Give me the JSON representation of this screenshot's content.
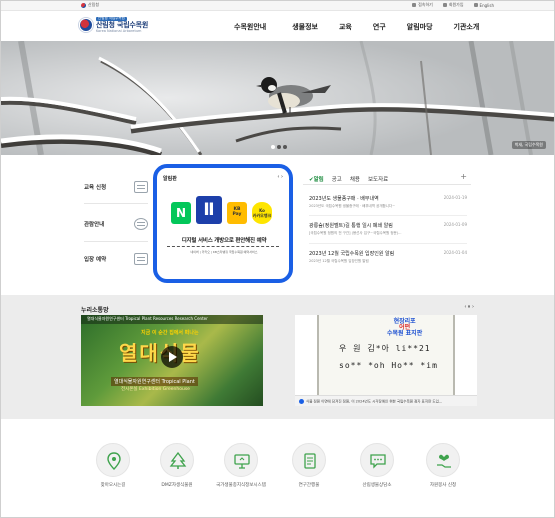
{
  "util": {
    "gov_label": "산림청",
    "links": [
      "접속하기",
      "회원가입",
      "English"
    ]
  },
  "logo": {
    "small": "산림청 국립수목원",
    "ko": "산림청 국립수목원",
    "en": "Korea National Arboretum"
  },
  "nav": [
    "수목원안내",
    "생물정보",
    "교육",
    "연구",
    "알림마당",
    "기관소개"
  ],
  "hero": {
    "caption": "박새, 국립수목원",
    "slide_count": 3
  },
  "quick_links": [
    "교육 신청",
    "관람안내",
    "입장 예약"
  ],
  "notice_panel": {
    "title": "알림판",
    "control": "‹ ›",
    "tiles": {
      "naver": "N",
      "big": "Ⅱ",
      "kbpay_top": "KB",
      "kbpay_bottom": "Pay",
      "kakao_top": "Ko",
      "kakao_bottom": "카카오뱅크"
    },
    "message": "디지털 서비스 개방으로 편안해진 예약",
    "fineprint": "네이버 | 카카오 | KB스타뱅킹 국립수목원 예약서비스"
  },
  "board": {
    "tabs": [
      "✔알림",
      "공고",
      "채용",
      "보도자료"
    ],
    "plus": "+",
    "items": [
      {
        "title": "2023년도 생물종구매 · 배부내역",
        "date": "2024-01-19",
        "summary": "2023년도 국립수목원 생물종구매 · 배부내역 공개합니다~"
      },
      {
        "title": "광릉숲(정원벨트)길 통행 일시 폐쇄 알림",
        "date": "2024-01-09",
        "summary": "[국립수목원 정원의 전 구간] (봉선사 입구~국립수목원 정문)..."
      },
      {
        "title": "2023년 12월 국립수목원 입장인원 알림",
        "date": "2024-01-04",
        "summary": "2023년 12월 국립수목원 입장인원 알림"
      }
    ]
  },
  "media": {
    "title": "누리소통망",
    "control": "‹ ⏸ ›",
    "video1": {
      "band": "열대식물자원연구센터 Tropical Plant Resources Research Center",
      "sub": "지금 이 순간 집에서 떠나는",
      "big": "열대식물",
      "cap1": "열대식물자원연구센터 Tropical Plant",
      "cap2": "전시온실 Exhibition Greenhouse"
    },
    "video2": {
      "label_top": "현장리포",
      "label_mid": "어떤",
      "label_bottom": "수목원 표지판",
      "line1": "우 원  김*아  li**21",
      "line2": "so** *oh  Ho** *im",
      "strip": "식물 정원 이면에 담겨진 정원, 이 2024년도 시각장애인 위한 국립수목원 점자 표지판 도입..."
    }
  },
  "bottom_icons": [
    {
      "label": "찾아오시는길",
      "icon": "map-pin-icon"
    },
    {
      "label": "DMZ자생식물원",
      "icon": "tree-icon"
    },
    {
      "label": "국가생물종지식정보시스템",
      "icon": "monitor-icon"
    },
    {
      "label": "연구간행물",
      "icon": "document-icon"
    },
    {
      "label": "산림생물상담소",
      "icon": "chat-icon"
    },
    {
      "label": "자원봉사 신청",
      "icon": "heart-hand-icon"
    }
  ]
}
